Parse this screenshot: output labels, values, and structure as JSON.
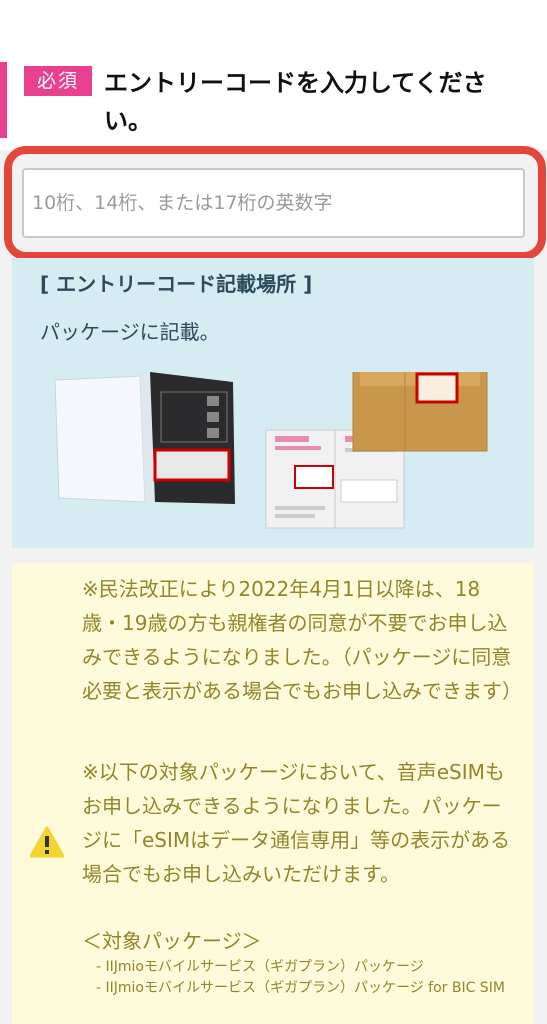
{
  "form": {
    "required_badge": "必須",
    "title": "エントリーコードを入力してください。",
    "entry_input": {
      "value": "",
      "placeholder": "10桁、14桁、または17桁の英数字"
    }
  },
  "location_info": {
    "title": "[ エントリーコード記載場所 ]",
    "text": "パッケージに記載。"
  },
  "notice": {
    "paragraph1": "※民法改正により2022年4月1日以降は、18歳・19歳の方も親権者の同意が不要でお申し込みできるようになりました。（パッケージに同意必要と表示がある場合でもお申し込みできます）",
    "paragraph2": "※以下の対象パッケージにおいて、音声eSIMもお申し込みできるようになりました。パッケージに「eSIMはデータ通信専用」等の表示がある場合でもお申し込みいただけます。",
    "target_heading": "＜対象パッケージ＞",
    "targets": [
      "- IIJmioモバイルサービス（ギガプラン）パッケージ",
      "- IIJmioモバイルサービス（ギガプラン）パッケージ for BIC SIM"
    ]
  },
  "colors": {
    "accent_pink": "#e9408f",
    "highlight_red": "#e5463b",
    "info_bg": "#d5ecf2",
    "warning_bg": "#fdfbd9",
    "warning_text": "#93852a"
  },
  "icons": [
    "warning-icon"
  ]
}
